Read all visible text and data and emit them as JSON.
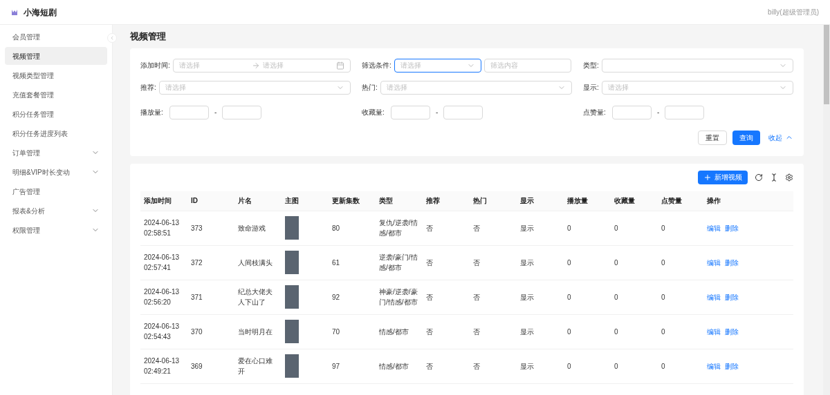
{
  "header": {
    "brand": "小海短剧",
    "user": "billy(超级管理员)"
  },
  "sidebar": {
    "items": [
      {
        "label": "会员管理",
        "selected": false,
        "expandable": false
      },
      {
        "label": "视频管理",
        "selected": true,
        "expandable": false
      },
      {
        "label": "视频类型管理",
        "selected": false,
        "expandable": false
      },
      {
        "label": "充值套餐管理",
        "selected": false,
        "expandable": false
      },
      {
        "label": "积分任务管理",
        "selected": false,
        "expandable": false
      },
      {
        "label": "积分任务进度列表",
        "selected": false,
        "expandable": false
      },
      {
        "label": "订单管理",
        "selected": false,
        "expandable": true
      },
      {
        "label": "明细&VIP时长变动",
        "selected": false,
        "expandable": true
      },
      {
        "label": "广告管理",
        "selected": false,
        "expandable": false
      },
      {
        "label": "报表&分析",
        "selected": false,
        "expandable": true
      },
      {
        "label": "权限管理",
        "selected": false,
        "expandable": true
      }
    ]
  },
  "page_title": "视频管理",
  "filters": {
    "date": {
      "label": "添加时间:",
      "start_placeholder": "请选择",
      "end_placeholder": "请选择"
    },
    "condition": {
      "label": "筛选条件:",
      "placeholder": "请选择",
      "content_placeholder": "筛选内容",
      "focused": true
    },
    "type": {
      "label": "类型:"
    },
    "selects": [
      {
        "label": "推荐:",
        "placeholder": "请选择"
      },
      {
        "label": "热门:",
        "placeholder": "请选择"
      },
      {
        "label": "显示:",
        "placeholder": "请选择"
      }
    ],
    "ranges": [
      {
        "label": "播放量:",
        "separator": "-"
      },
      {
        "label": "收藏量:",
        "separator": "-"
      },
      {
        "label": "点赞量:",
        "separator": "-"
      }
    ],
    "reset": "重置",
    "search": "查询",
    "collapse": "收起"
  },
  "toolbar": {
    "add": "新增视频"
  },
  "table": {
    "columns": [
      "添加时间",
      "ID",
      "片名",
      "主图",
      "更新集数",
      "类型",
      "推荐",
      "热门",
      "显示",
      "播放量",
      "收藏量",
      "点赞量",
      "操作"
    ],
    "rows": [
      {
        "date": "2024-06-13",
        "time": "02:58:51",
        "id": "373",
        "title": "致命游戏",
        "episodes": "80",
        "type": "复仇/逆袭/情感/都市",
        "recommended": "否",
        "hot": "否",
        "display": "显示",
        "plays": "0",
        "favorites": "0",
        "likes": "0",
        "actions": [
          "编辑",
          "删除"
        ]
      },
      {
        "date": "2024-06-13",
        "time": "02:57:41",
        "id": "372",
        "title": "人间枝满头",
        "episodes": "61",
        "type": "逆袭/豪门/情感/都市",
        "recommended": "否",
        "hot": "否",
        "display": "显示",
        "plays": "0",
        "favorites": "0",
        "likes": "0",
        "actions": [
          "编辑",
          "删除"
        ]
      },
      {
        "date": "2024-06-13",
        "time": "02:56:20",
        "id": "371",
        "title": "纪总大佬夫人下山了",
        "episodes": "92",
        "type": "神豪/逆袭/豪门/情感/都市",
        "recommended": "否",
        "hot": "否",
        "display": "显示",
        "plays": "0",
        "favorites": "0",
        "likes": "0",
        "actions": [
          "编辑",
          "删除"
        ]
      },
      {
        "date": "2024-06-13",
        "time": "02:54:43",
        "id": "370",
        "title": "当时明月在",
        "episodes": "70",
        "type": "情感/都市",
        "recommended": "否",
        "hot": "否",
        "display": "显示",
        "plays": "0",
        "favorites": "0",
        "likes": "0",
        "actions": [
          "编辑",
          "删除"
        ]
      },
      {
        "date": "2024-06-13",
        "time": "02:49:21",
        "id": "369",
        "title": "爱在心口难开",
        "episodes": "97",
        "type": "情感/都市",
        "recommended": "否",
        "hot": "否",
        "display": "显示",
        "plays": "0",
        "favorites": "0",
        "likes": "0",
        "actions": [
          "编辑",
          "删除"
        ]
      }
    ]
  }
}
